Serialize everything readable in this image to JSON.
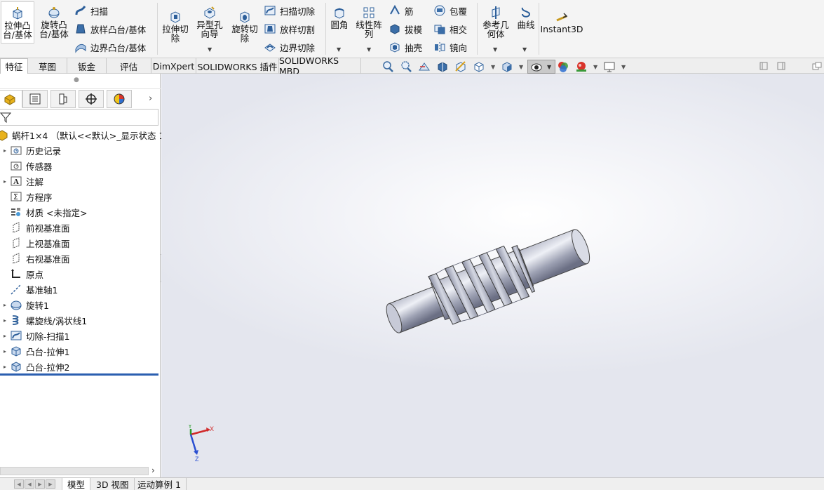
{
  "ribbon": {
    "extrude_boss": "拉伸凸\n台/基体",
    "revolve_boss": "旋转凸\n台/基体",
    "sweep": "扫描",
    "loft_boss": "放样凸台/基体",
    "boundary_boss": "边界凸台/基体",
    "extrude_cut": "拉伸切\n除",
    "hole_wizard": "异型孔\n向导",
    "revolve_cut": "旋转切\n除",
    "swept_cut": "扫描切除",
    "lofted_cut": "放样切割",
    "boundary_cut": "边界切除",
    "fillet": "圆角",
    "linear_pattern": "线性阵\n列",
    "rib": "筋",
    "draft": "拔模",
    "shell": "抽壳",
    "wrap": "包覆",
    "intersect": "相交",
    "mirror": "镜向",
    "reference_geometry": "参考几\n何体",
    "curves": "曲线",
    "instant3d": "Instant3D"
  },
  "command_tabs": [
    "特征",
    "草图",
    "钣金",
    "评估",
    "DimXpert",
    "SOLIDWORKS 插件",
    "SOLIDWORKS MBD"
  ],
  "tree": {
    "root": "蜗杆1×4 （默认<<默认>_显示状态 1>）",
    "items": [
      {
        "label": "历史记录",
        "icon": "history-folder-icon",
        "expand": true
      },
      {
        "label": "传感器",
        "icon": "sensor-folder-icon",
        "expand": false
      },
      {
        "label": "注解",
        "icon": "annotations-icon",
        "expand": true
      },
      {
        "label": "方程序",
        "icon": "equations-icon",
        "expand": false
      },
      {
        "label": "材质 <未指定>",
        "icon": "material-icon",
        "expand": false
      },
      {
        "label": "前视基准面",
        "icon": "plane-icon",
        "expand": false
      },
      {
        "label": "上视基准面",
        "icon": "plane-icon",
        "expand": false
      },
      {
        "label": "右视基准面",
        "icon": "plane-icon",
        "expand": false
      },
      {
        "label": "原点",
        "icon": "origin-icon",
        "expand": false
      },
      {
        "label": "基准轴1",
        "icon": "axis-icon",
        "expand": false
      },
      {
        "label": "旋转1",
        "icon": "revolve-feature-icon",
        "expand": true
      },
      {
        "label": "螺旋线/涡状线1",
        "icon": "helix-icon",
        "expand": true
      },
      {
        "label": "切除-扫描1",
        "icon": "swept-cut-feature-icon",
        "expand": true
      },
      {
        "label": "凸台-拉伸1",
        "icon": "extrude-feature-icon",
        "expand": true
      },
      {
        "label": "凸台-拉伸2",
        "icon": "extrude-feature-icon",
        "expand": true
      }
    ]
  },
  "bottom_tabs": [
    "模型",
    "3D 视图",
    "运动算例 1"
  ],
  "triad": {
    "x": "X",
    "y": "Y",
    "z": "Z"
  }
}
